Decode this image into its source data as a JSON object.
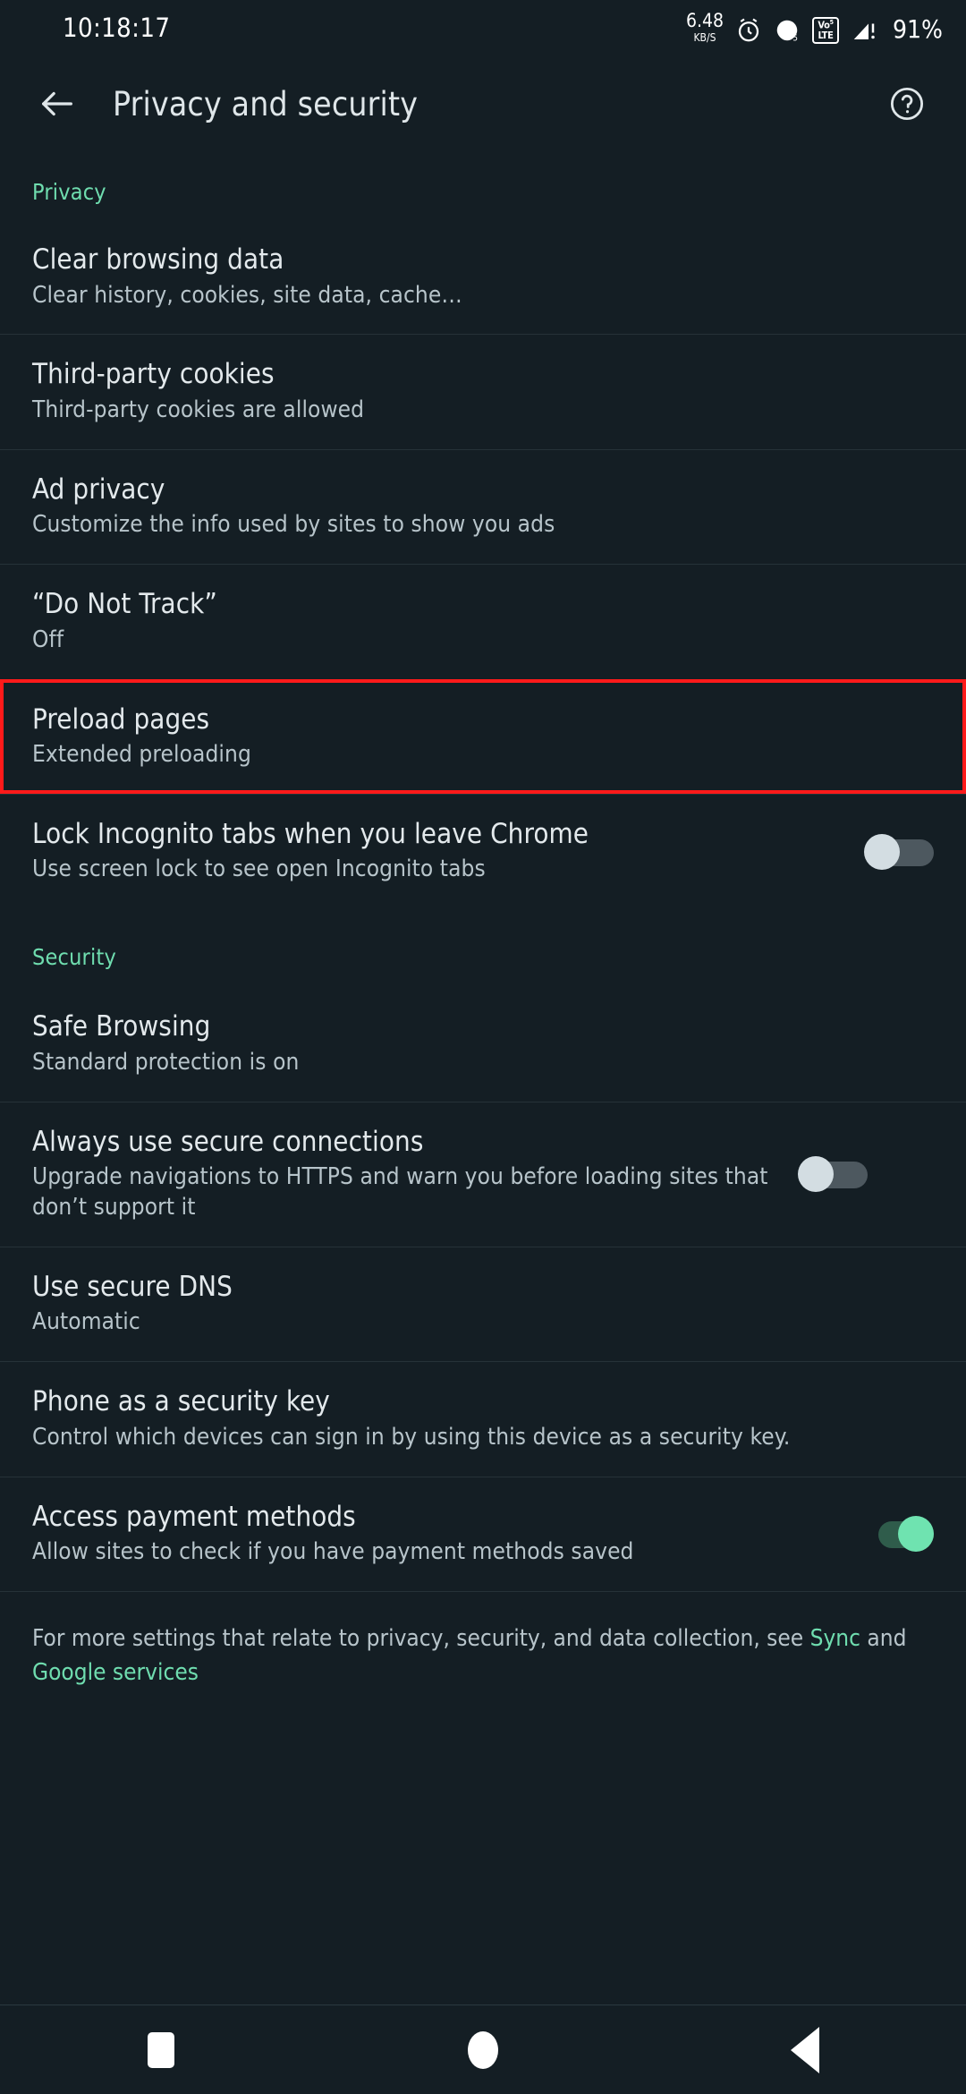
{
  "status_bar": {
    "time": "10:18:17",
    "data_rate_value": "6.48",
    "data_rate_unit": "KB/S",
    "alarm_icon": "alarm-clock-icon",
    "wifi_icon": "wifi-icon",
    "volte_top": "Vo",
    "volte_sup": "5",
    "volte_bottom": "LTE",
    "signal_icon": "signal-warning-icon",
    "battery": "91%"
  },
  "toolbar": {
    "back_icon": "back-arrow-icon",
    "title": "Privacy and security",
    "help_icon": "help-circle-icon"
  },
  "sections": {
    "privacy_label": "Privacy",
    "security_label": "Security"
  },
  "privacy_items": [
    {
      "title": "Clear browsing data",
      "summary": "Clear history, cookies, site data, cache…"
    },
    {
      "title": "Third-party cookies",
      "summary": "Third-party cookies are allowed"
    },
    {
      "title": "Ad privacy",
      "summary": "Customize the info used by sites to show you ads"
    },
    {
      "title": "“Do Not Track”",
      "summary": "Off"
    },
    {
      "title": "Preload pages",
      "summary": "Extended preloading"
    },
    {
      "title": "Lock Incognito tabs when you leave Chrome",
      "summary": "Use screen lock to see open Incognito tabs",
      "toggle": "off"
    }
  ],
  "security_items": [
    {
      "title": "Safe Browsing",
      "summary": "Standard protection is on"
    },
    {
      "title": "Always use secure connections",
      "summary": "Upgrade navigations to HTTPS and warn you before loading sites that don’t support it",
      "toggle": "off"
    },
    {
      "title": "Use secure DNS",
      "summary": "Automatic"
    },
    {
      "title": "Phone as a security key",
      "summary": "Control which devices can sign in by using this device as a security key."
    },
    {
      "title": "Access payment methods",
      "summary": "Allow sites to check if you have payment methods saved",
      "toggle": "on"
    }
  ],
  "footer": {
    "lead": "For more settings that relate to privacy, security, and data collection, see ",
    "link_sync": "Sync",
    "conjunction": " and ",
    "link_google": "Google services"
  },
  "nav_bar": {
    "recents_icon": "square-recents-icon",
    "home_icon": "circle-home-icon",
    "back_icon": "triangle-back-icon"
  },
  "annotation": {
    "target": "Preload pages",
    "color": "#ff1a1a"
  },
  "colors": {
    "background": "#141e24",
    "accent_green": "#6fddaf",
    "title_text": "#e3e9ec",
    "summary_text": "#b7c4ca",
    "divider": "#263238",
    "toggle_on_knob": "#6fe3b0",
    "toggle_on_track": "#2f5c4b",
    "toggle_off_knob": "#d3dde2",
    "toggle_off_track": "#4d585f"
  }
}
